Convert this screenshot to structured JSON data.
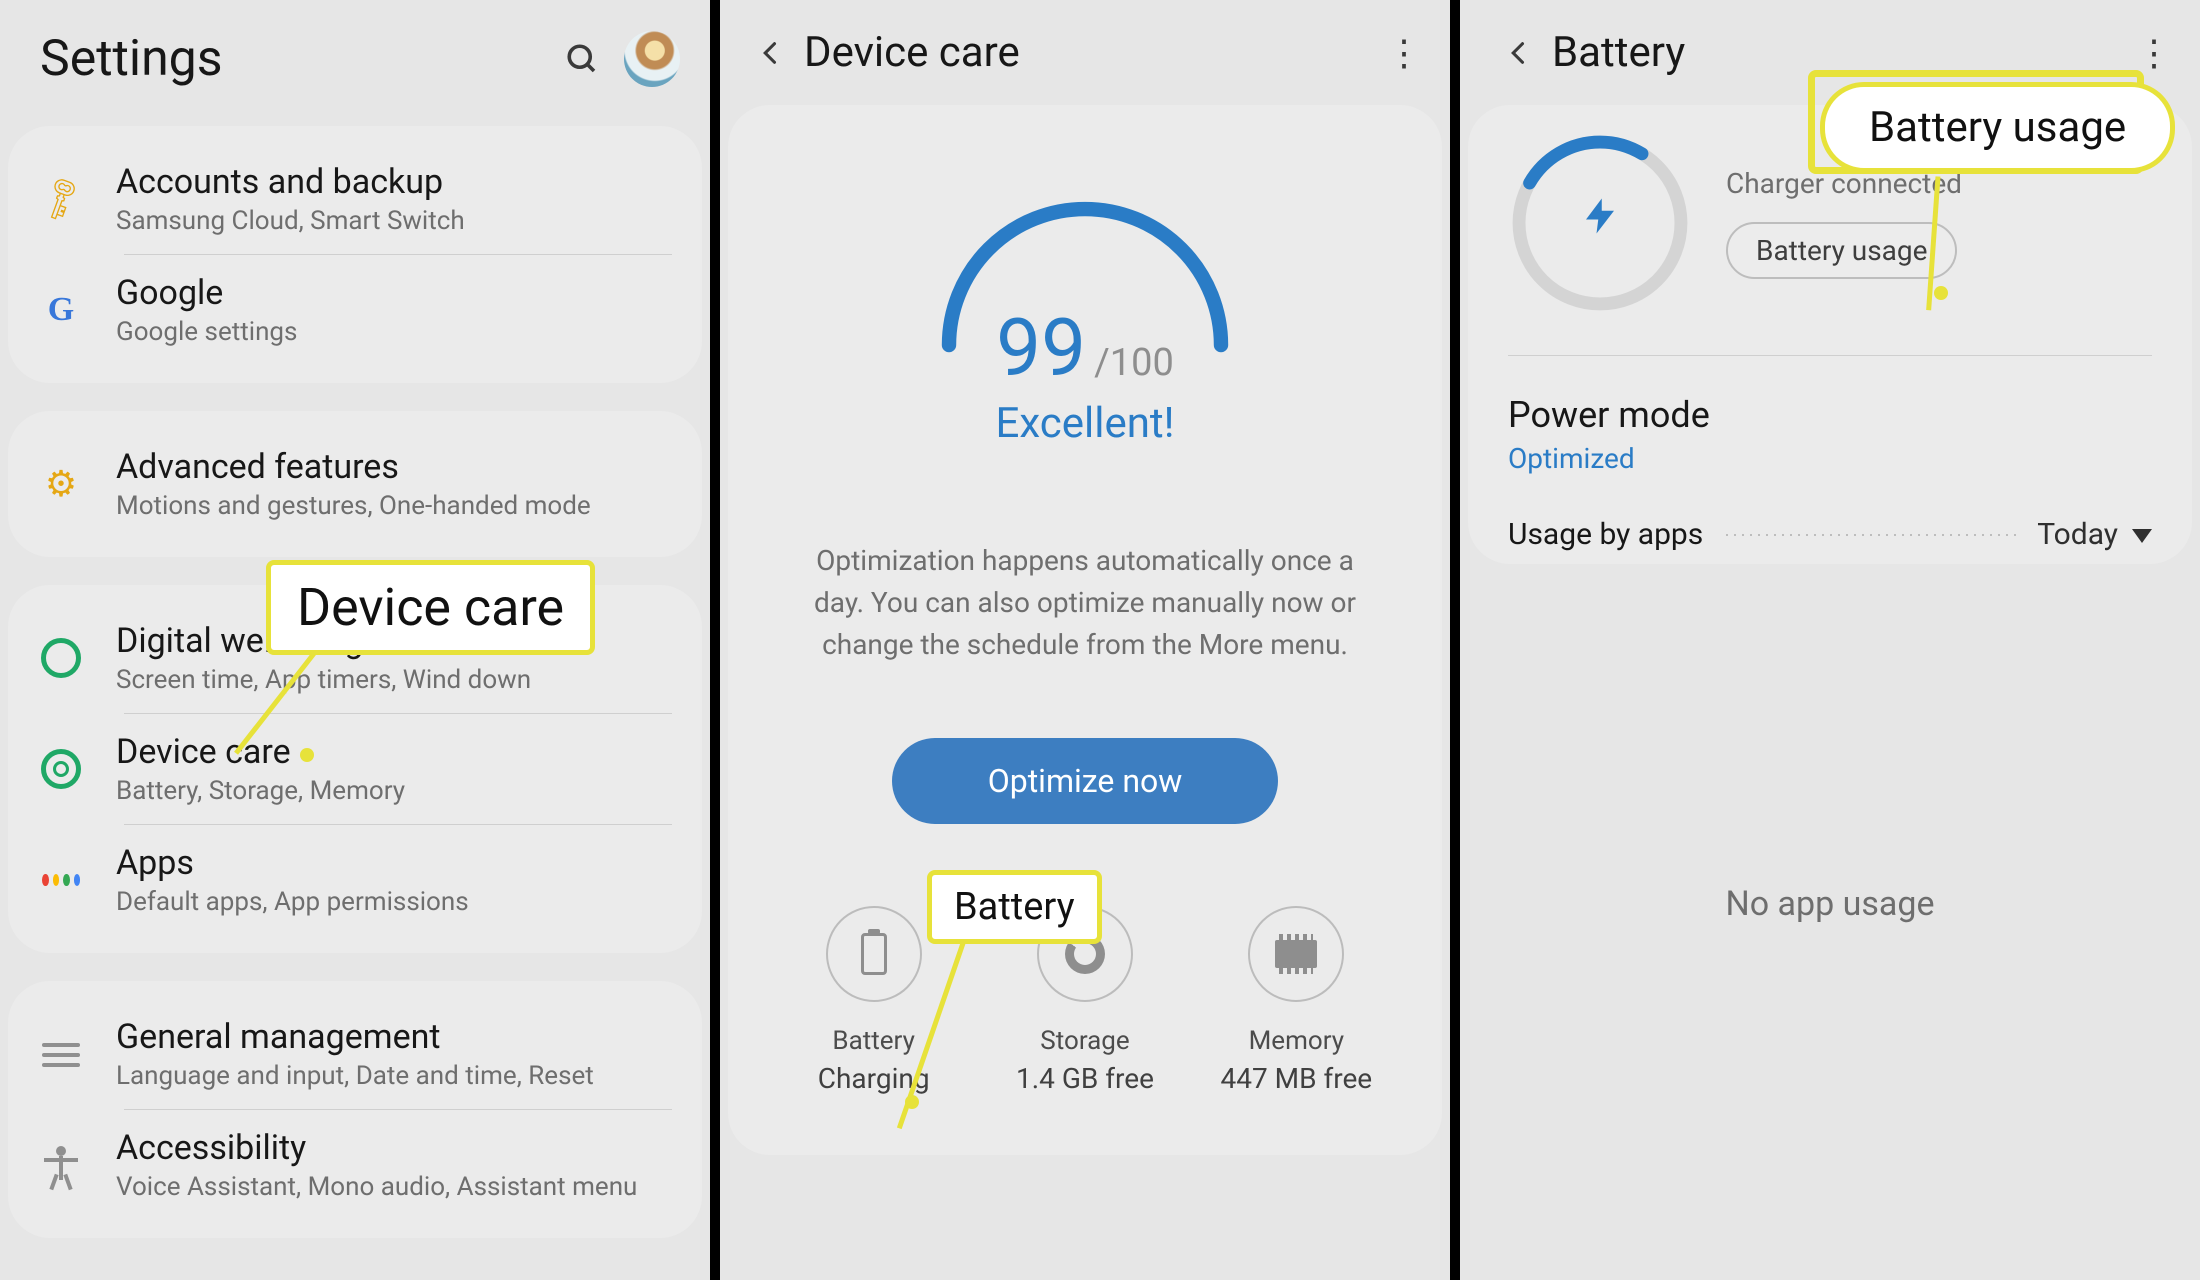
{
  "panel1": {
    "header_title": "Settings",
    "groups": [
      {
        "items": [
          {
            "id": "accounts",
            "title": "Accounts and backup",
            "subtitle": "Samsung Cloud, Smart Switch"
          },
          {
            "id": "google",
            "title": "Google",
            "subtitle": "Google settings"
          }
        ]
      },
      {
        "items": [
          {
            "id": "advanced",
            "title": "Advanced features",
            "subtitle": "Motions and gestures, One-handed mode"
          }
        ]
      },
      {
        "items": [
          {
            "id": "wellbeing",
            "title": "Digital wellbeing",
            "subtitle": "Screen time, App timers, Wind down"
          },
          {
            "id": "devicecare",
            "title": "Device care",
            "subtitle": "Battery, Storage, Memory"
          },
          {
            "id": "apps",
            "title": "Apps",
            "subtitle": "Default apps, App permissions"
          }
        ]
      },
      {
        "items": [
          {
            "id": "general",
            "title": "General management",
            "subtitle": "Language and input, Date and time, Reset"
          },
          {
            "id": "accessibility",
            "title": "Accessibility",
            "subtitle": "Voice Assistant, Mono audio, Assistant menu"
          }
        ]
      }
    ]
  },
  "panel2": {
    "header_title": "Device care",
    "score_value": "99",
    "score_max": "/100",
    "score_label": "Excellent!",
    "description": "Optimization happens automatically once a day. You can also optimize manually now or change the schedule from the More menu.",
    "optimize_button": "Optimize now",
    "categories": [
      {
        "id": "battery",
        "name": "Battery",
        "value": "Charging"
      },
      {
        "id": "storage",
        "name": "Storage",
        "value": "1.4 GB free"
      },
      {
        "id": "memory",
        "name": "Memory",
        "value": "447 MB free"
      }
    ]
  },
  "panel3": {
    "header_title": "Battery",
    "charger_status": "Charger connected",
    "mini_pill_label": "Battery usage",
    "power_mode_label": "Power mode",
    "power_mode_value": "Optimized",
    "usage_label": "Usage by apps",
    "usage_filter": "Today",
    "no_usage_text": "No app usage"
  },
  "callouts": {
    "device_care": "Device care",
    "battery": "Battery",
    "battery_usage": "Battery usage"
  },
  "colors": {
    "accent_blue": "#2a7cc6",
    "highlight_yellow": "#e7e23a"
  }
}
